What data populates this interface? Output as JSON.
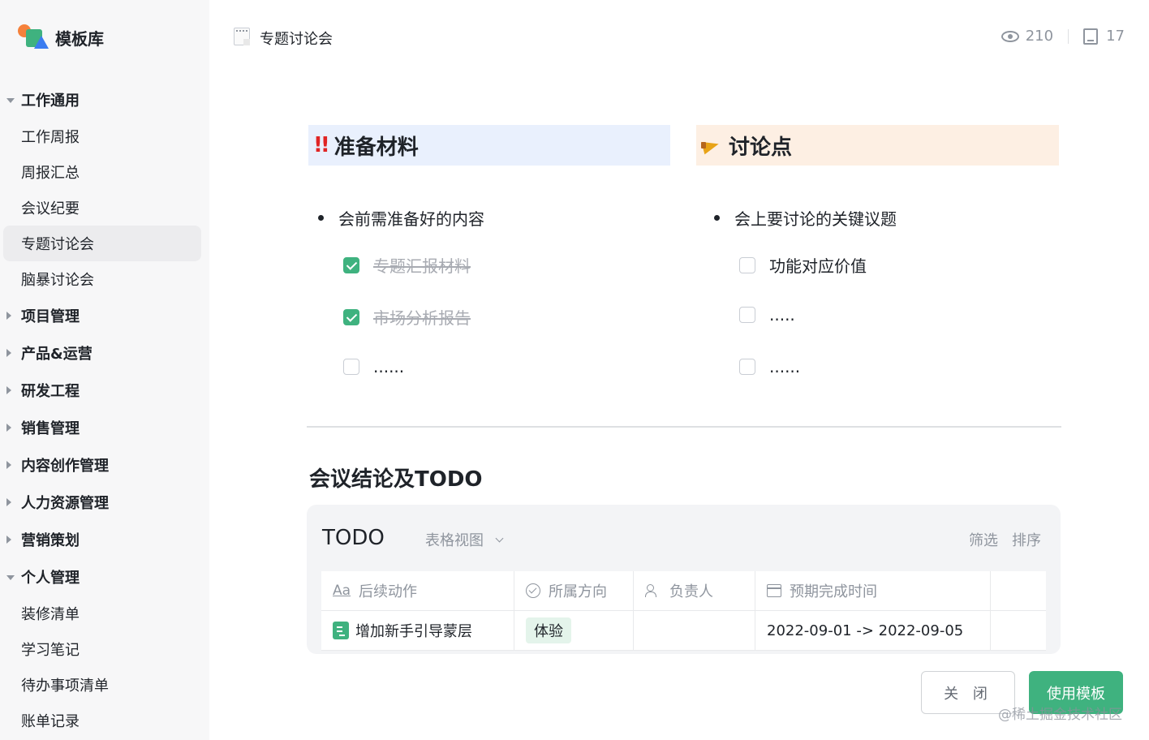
{
  "app": {
    "logo_text": "模板库"
  },
  "sidebar": {
    "sections": [
      {
        "label": "工作通用",
        "expanded": true,
        "items": [
          "工作周报",
          "周报汇总",
          "会议纪要",
          "专题讨论会",
          "脑暴讨论会"
        ],
        "active": "专题讨论会"
      },
      {
        "label": "项目管理",
        "expanded": false
      },
      {
        "label": "产品&运营",
        "expanded": false
      },
      {
        "label": "研发工程",
        "expanded": false
      },
      {
        "label": "销售管理",
        "expanded": false
      },
      {
        "label": "内容创作管理",
        "expanded": false
      },
      {
        "label": "人力资源管理",
        "expanded": false
      },
      {
        "label": "营销策划",
        "expanded": false
      },
      {
        "label": "个人管理",
        "expanded": true,
        "items": [
          "装修清单",
          "学习笔记",
          "待办事项清单",
          "账单记录"
        ]
      }
    ]
  },
  "header": {
    "title": "专题讨论会",
    "views": "210",
    "uses": "17"
  },
  "left_section": {
    "title": "准备材料",
    "bullet": "会前需准备好的内容",
    "checks": [
      {
        "text": "专题汇报材料",
        "checked": true
      },
      {
        "text": "市场分析报告",
        "checked": true
      },
      {
        "text": "......",
        "checked": false
      }
    ]
  },
  "right_section": {
    "title": "讨论点",
    "bullet": "会上要讨论的关键议题",
    "checks": [
      {
        "text": "功能对应价值",
        "checked": false
      },
      {
        "text": ".....",
        "checked": false
      },
      {
        "text": "......",
        "checked": false
      }
    ]
  },
  "conclusion_heading": "会议结论及TODO",
  "todo": {
    "title": "TODO",
    "view": "表格视图",
    "filter": "筛选",
    "sort": "排序",
    "columns": [
      "后续动作",
      "所属方向",
      "负责人",
      "预期完成时间"
    ],
    "rows": [
      {
        "action": "增加新手引导蒙层",
        "direction": "体验",
        "owner": "",
        "date": "2022-09-01 -> 2022-09-05"
      }
    ]
  },
  "footer": {
    "close_label": "关 闭",
    "use_label": "使用模板",
    "watermark": "@稀土掘金技术社区"
  },
  "colors": {
    "accent_green": "#3fb27f",
    "left_header_bg": "#e9f0fd",
    "right_header_bg": "#fdefe3"
  }
}
